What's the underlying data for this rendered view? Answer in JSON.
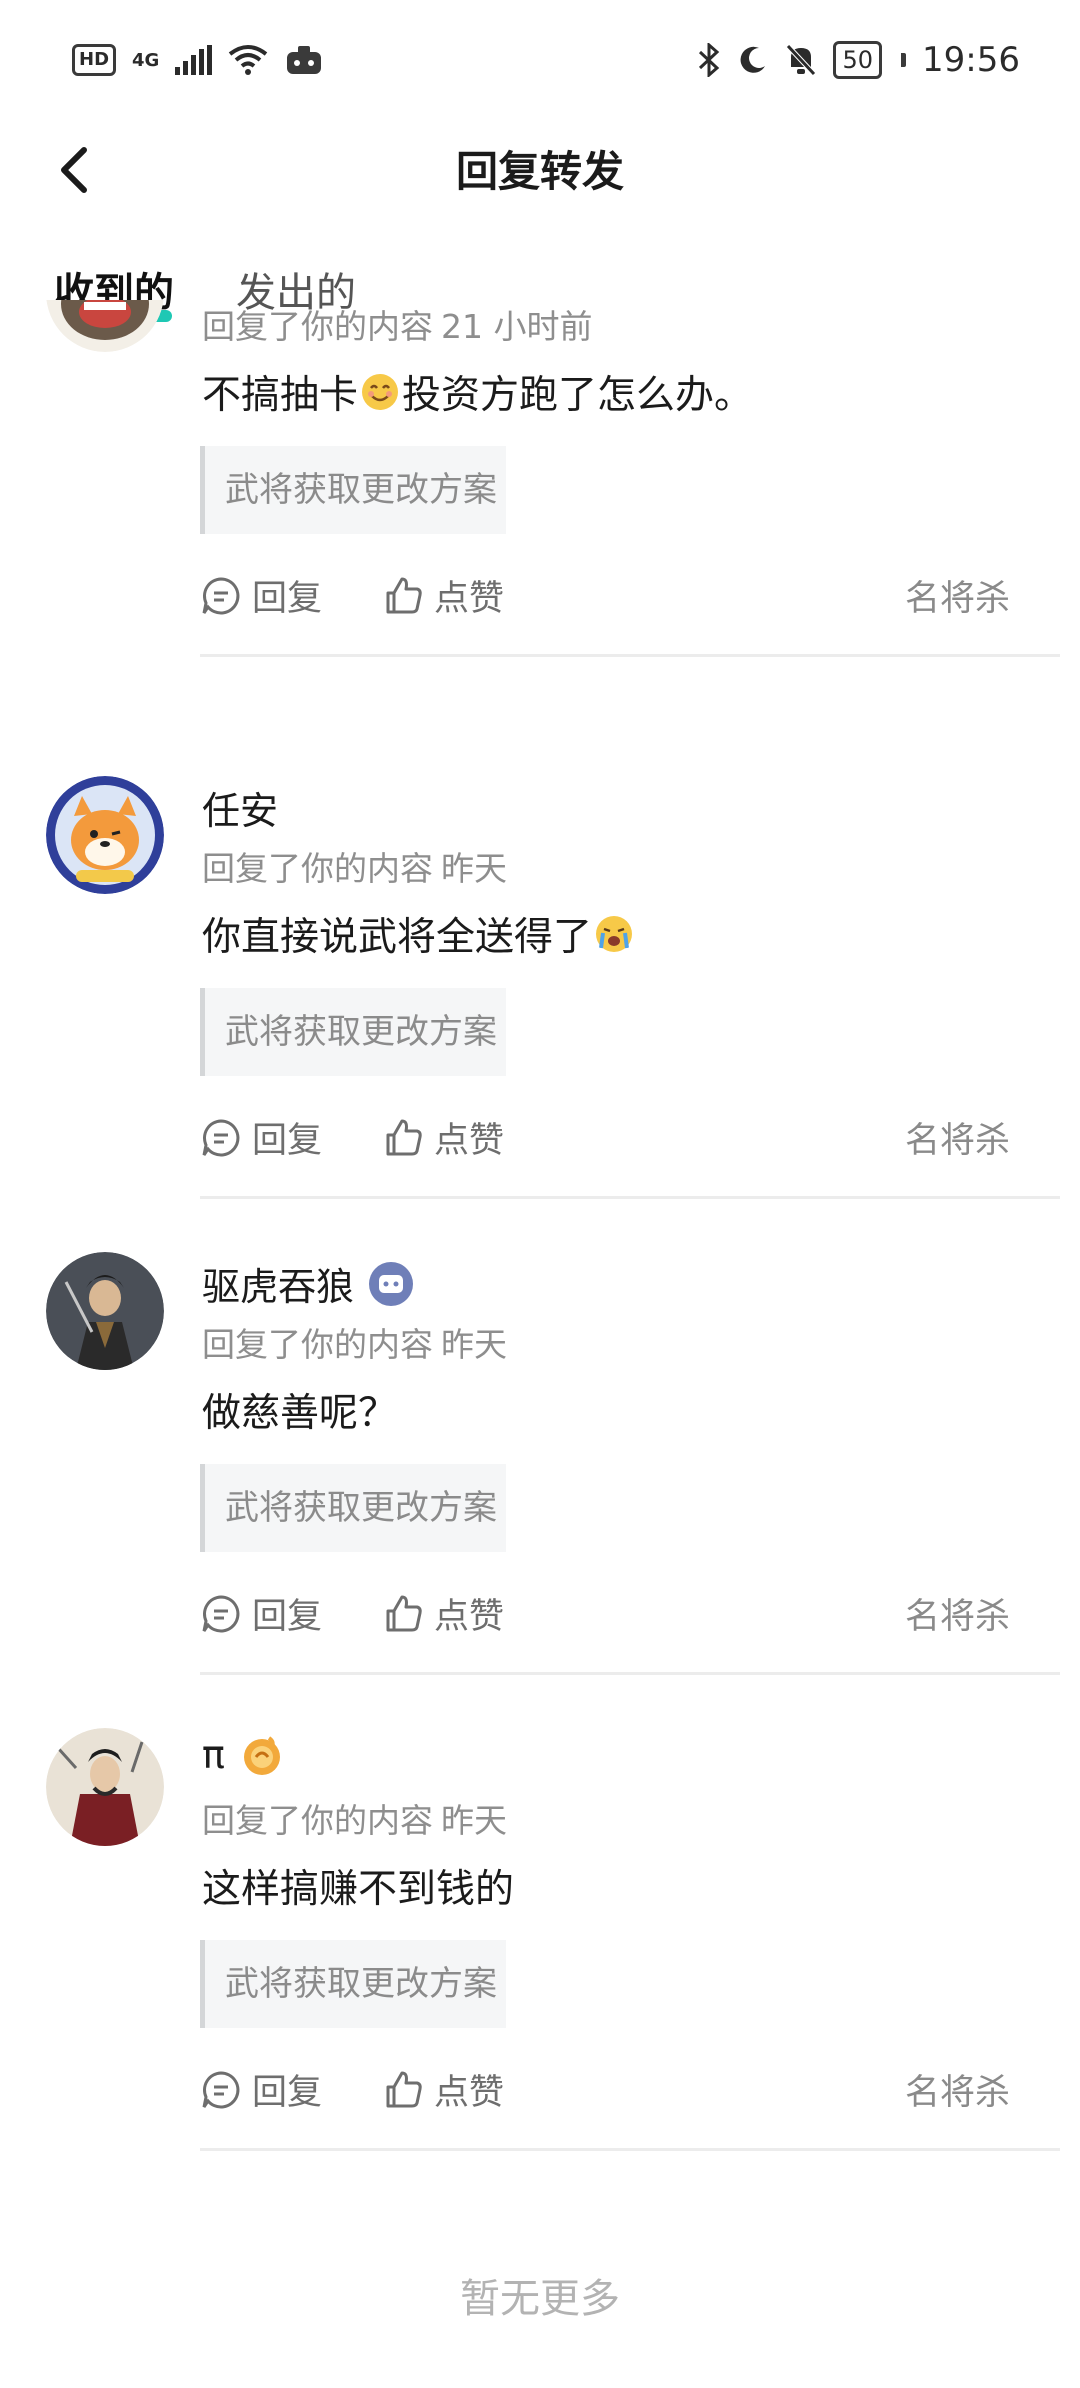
{
  "status_bar": {
    "hd": "HD",
    "network": "4G",
    "time": "19:56",
    "battery": "50"
  },
  "header": {
    "title": "回复转发"
  },
  "tabs": {
    "received": "收到的",
    "sent": "发出的"
  },
  "accent_color": "#1ec8b4",
  "items": [
    {
      "username": "",
      "action": "回复了你的内容",
      "time": "21 小时前",
      "content_before": "不搞抽卡",
      "content_after": "投资方跑了怎么办。",
      "emoji": "smiling-face-icon",
      "quote": "武将获取更改方案",
      "reply_label": "回复",
      "like_label": "点赞",
      "game": "名将杀"
    },
    {
      "username": "任安",
      "action": "回复了你的内容",
      "time": "昨天",
      "content_before": "你直接说武将全送得了",
      "content_after": "",
      "emoji": "crying-face-icon",
      "quote": "武将获取更改方案",
      "reply_label": "回复",
      "like_label": "点赞",
      "game": "名将杀"
    },
    {
      "username": "驱虎吞狼",
      "action": "回复了你的内容",
      "time": "昨天",
      "content_before": "做慈善呢？",
      "content_after": "",
      "quote": "武将获取更改方案",
      "reply_label": "回复",
      "like_label": "点赞",
      "game": "名将杀"
    },
    {
      "username": "π",
      "action": "回复了你的内容",
      "time": "昨天",
      "content_before": "这样搞赚不到钱的",
      "content_after": "",
      "quote": "武将获取更改方案",
      "reply_label": "回复",
      "like_label": "点赞",
      "game": "名将杀"
    }
  ],
  "footer": {
    "no_more": "暂无更多"
  }
}
